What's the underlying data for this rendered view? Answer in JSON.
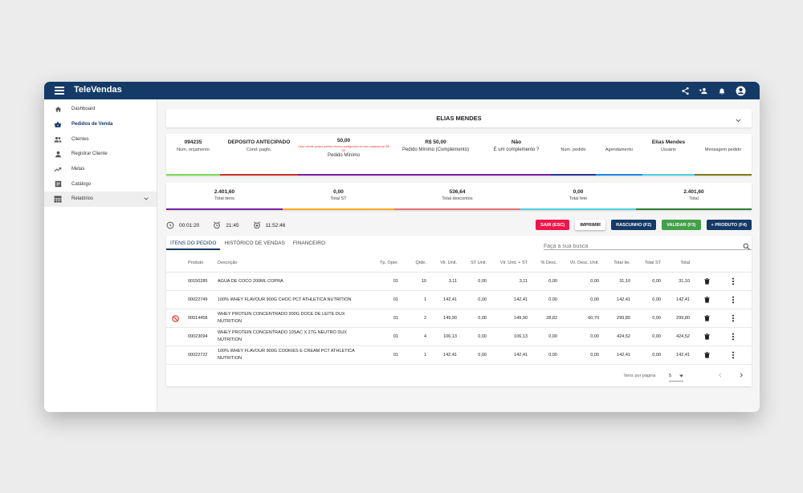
{
  "app": {
    "title": "TeleVendas"
  },
  "sidebar": {
    "items": [
      {
        "label": "Dashboard",
        "icon": "home-icon"
      },
      {
        "label": "Pedidos de Venda",
        "icon": "basket-icon"
      },
      {
        "label": "Clientes",
        "icon": "people-icon"
      },
      {
        "label": "Registrar Cliente",
        "icon": "person-icon"
      },
      {
        "label": "Metas",
        "icon": "trending-up-icon"
      },
      {
        "label": "Catálogo",
        "icon": "catalog-icon"
      },
      {
        "label": "Relatórios",
        "icon": "table-icon"
      }
    ]
  },
  "customer": {
    "name": "ELIAS MENDES"
  },
  "info": [
    {
      "value": "094235",
      "label": "Núm. orçamento",
      "color": "#7ed957"
    },
    {
      "value": "DEPOSITO ANTECIPADO",
      "label": "Cond. pagto.",
      "color": "#d32f2f"
    },
    {
      "value": "50,00",
      "warning": "Esse cliente possui pedido mínimo configurado em seu cadastro de R$ 50",
      "label": "Pedido Mínimo",
      "color": "#7b1fa2"
    },
    {
      "value": "R$ 50,00",
      "label": "Pedido Mínimo (Complemento)",
      "color": "#7b1fa2"
    },
    {
      "value": "Não",
      "label": "É um complemento ?",
      "color": "#7b1fa2"
    },
    {
      "value": "",
      "label": "Num. pedido",
      "color": "#283593"
    },
    {
      "value": "",
      "label": "Agendamento",
      "color": "#1e88e5"
    },
    {
      "value": "Elias Mendes",
      "label": "Usuário",
      "color": "#4dd0e1"
    },
    {
      "value": "",
      "label": "Mensagem pedido",
      "color": "#827717"
    }
  ],
  "totals": [
    {
      "value": "2.401,60",
      "label": "Total itens",
      "color": "#7b1fa2"
    },
    {
      "value": "0,00",
      "label": "Total ST",
      "color": "#f9a825"
    },
    {
      "value": "536,64",
      "label": "Total descontos",
      "color": "#e57373"
    },
    {
      "value": "0,00",
      "label": "Total fete",
      "color": "#4dd0e1"
    },
    {
      "value": "2.401,60",
      "label": "Total",
      "color": "#2e7d32"
    }
  ],
  "timers": [
    {
      "icon": "clock-icon",
      "value": "00:01:20"
    },
    {
      "icon": "alarm-icon",
      "value": "21:45"
    },
    {
      "icon": "alarm-add-icon",
      "value": "11:52:46"
    }
  ],
  "actions": [
    {
      "label": "SAIR (ESC)",
      "bg": "#f0164a",
      "fg": "#ffffff"
    },
    {
      "label": "IMPRIMIR",
      "bg": "#ffffff",
      "fg": "#222222"
    },
    {
      "label": "RASCUNHO (F2)",
      "bg": "#143a67",
      "fg": "#ffffff"
    },
    {
      "label": "VALIDAR (F3)",
      "bg": "#43a047",
      "fg": "#ffffff"
    },
    {
      "label": "+ PRODUTO (F4)",
      "bg": "#143a67",
      "fg": "#ffffff"
    }
  ],
  "tabs": [
    "ITENS DO PEDIDO",
    "HISTÓRICO DE VENDAS",
    "FINANCEIRO"
  ],
  "search": {
    "placeholder": "Faça a sua busca"
  },
  "table": {
    "columns": [
      "Produto",
      "Descrição",
      "Tp. Oper.",
      "Qtde.",
      "Vlr. Unit.",
      "ST Unit.",
      "Vlr. Unit. + ST",
      "% Desc.",
      "Vlr. Desc. Unit.",
      "Total Ite.",
      "Total ST",
      "Total"
    ],
    "rows": [
      {
        "flag": false,
        "cells": [
          "00150285",
          "AGUA DE COCO 200ML COPRA",
          "01",
          "10",
          "3,11",
          "0,00",
          "3,11",
          "0,00",
          "0,00",
          "31,10",
          "0,00",
          "31,10"
        ]
      },
      {
        "flag": false,
        "cells": [
          "00022749",
          "100% WHEY FLAVOUR 900G CHOC PCT ATHLETICA NUTRITION",
          "01",
          "1",
          "142,41",
          "0,00",
          "142,41",
          "0,00",
          "0,00",
          "142,41",
          "0,00",
          "142,41"
        ]
      },
      {
        "flag": true,
        "cells": [
          "00014458",
          "WHEY PROTEIN CONCENTRADO 900G DOCE DE LEITE DUX NUTRITION",
          "01",
          "2",
          "149,90",
          "0,00",
          "149,90",
          "28,82",
          "60,70",
          "299,80",
          "0,00",
          "299,80"
        ]
      },
      {
        "flag": false,
        "cells": [
          "00023094",
          "WHEY PROTEIN CONCENTRADO 10SAC X 27G NEUTRO DUX NUTRITION",
          "01",
          "4",
          "106,13",
          "0,00",
          "106,13",
          "0,00",
          "0,00",
          "424,52",
          "0,00",
          "424,52"
        ]
      },
      {
        "flag": false,
        "cells": [
          "00022722",
          "100% WHEY FLAVOUR 900G COOKIES E CREAM PCT ATHLETICA NUTRITION",
          "01",
          "1",
          "142,41",
          "0,00",
          "142,41",
          "0,00",
          "0,00",
          "142,41",
          "0,00",
          "142,41"
        ]
      }
    ]
  },
  "pager": {
    "label": "Itens por página",
    "size": "5"
  }
}
